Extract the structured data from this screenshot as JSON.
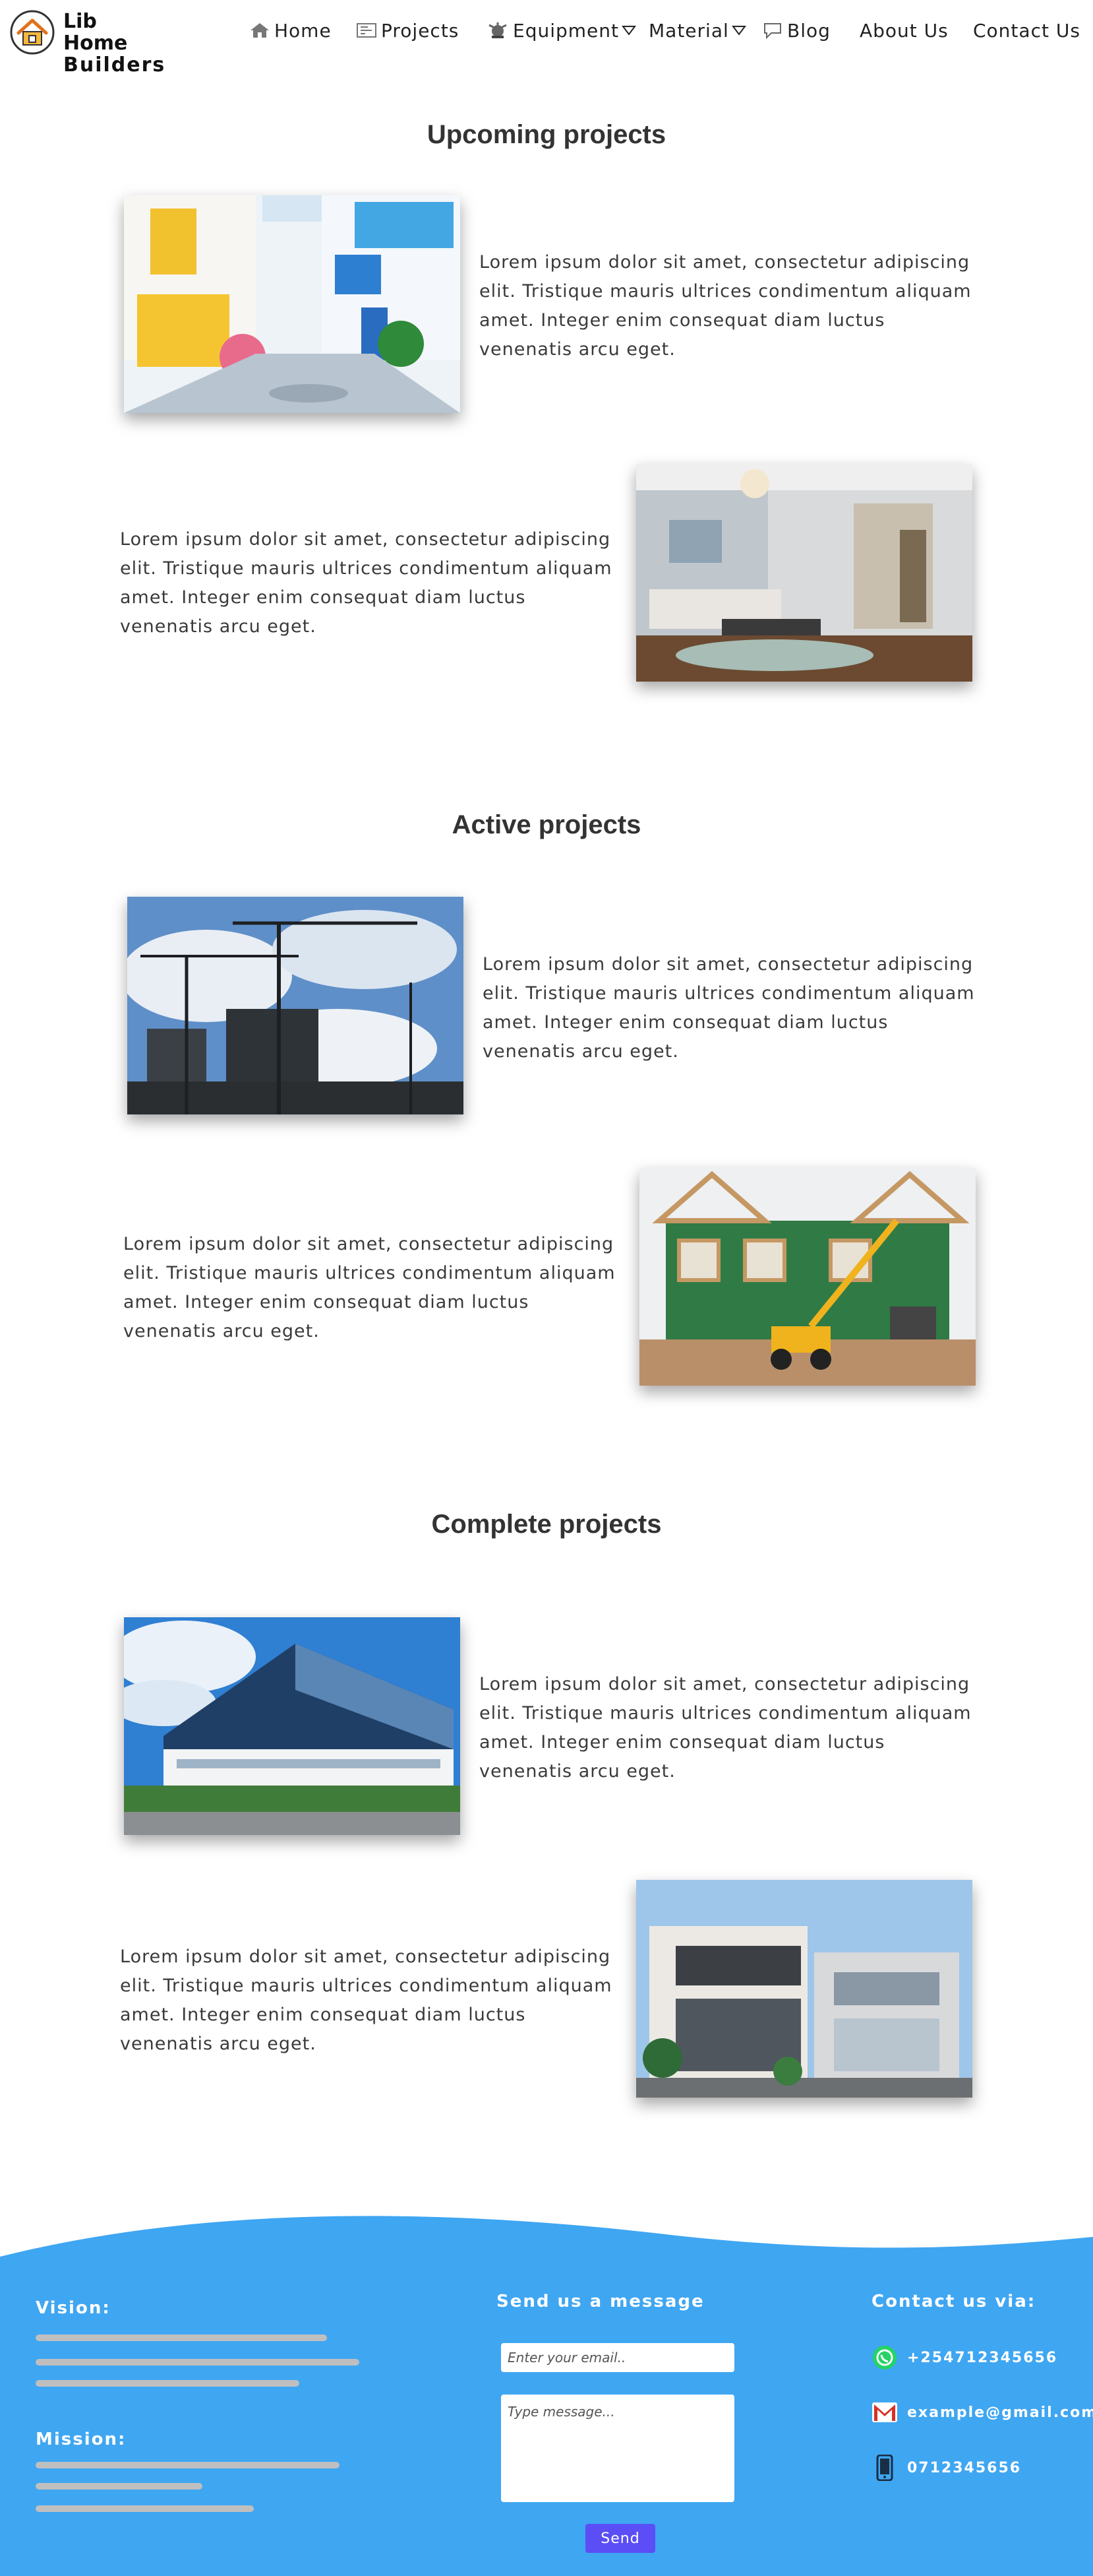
{
  "brand": {
    "line1": "Lib Home",
    "line2": "Builders"
  },
  "nav": {
    "home": "Home",
    "projects": "Projects",
    "equipment": "Equipment",
    "material": "Material",
    "blog": "Blog",
    "about": "About Us",
    "contact": "Contact Us"
  },
  "sections": {
    "upcoming": {
      "title": "Upcoming projects",
      "items": [
        {
          "text": "Lorem ipsum dolor sit amet, consectetur adipiscing elit. Tristique mauris ultrices condimentum aliquam amet. Integer enim consequat diam luctus venenatis arcu eget.",
          "image": "colorful-street-photo"
        },
        {
          "text": "Lorem ipsum dolor sit amet, consectetur adipiscing elit. Tristique mauris ultrices condimentum aliquam amet. Integer enim consequat diam luctus venenatis arcu eget.",
          "image": "living-room-photo"
        }
      ]
    },
    "active": {
      "title": "Active projects",
      "items": [
        {
          "text": "Lorem ipsum dolor sit amet, consectetur adipiscing elit. Tristique mauris ultrices condimentum aliquam amet. Integer enim consequat diam luctus venenatis arcu eget.",
          "image": "cranes-construction-photo"
        },
        {
          "text": "Lorem ipsum dolor sit amet, consectetur adipiscing elit. Tristique mauris ultrices condimentum aliquam amet. Integer enim consequat diam luctus venenatis arcu eget.",
          "image": "house-framing-photo"
        }
      ]
    },
    "complete": {
      "title": "Complete projects",
      "items": [
        {
          "text": "Lorem ipsum dolor sit amet, consectetur adipiscing elit. Tristique mauris ultrices condimentum aliquam amet. Integer enim consequat diam luctus venenatis arcu eget.",
          "image": "glass-office-building-photo"
        },
        {
          "text": "Lorem ipsum dolor sit amet, consectetur adipiscing elit. Tristique mauris ultrices condimentum aliquam amet. Integer enim consequat diam luctus venenatis arcu eget.",
          "image": "modern-house-photo"
        }
      ]
    }
  },
  "footer": {
    "vision": "Vision:",
    "mission": "Mission:",
    "message_heading": "Send us a message",
    "email_placeholder": "Enter your email..",
    "message_placeholder": "Type message...",
    "send": "Send",
    "contact_heading": "Contact us via:",
    "whatsapp": "+254712345656",
    "email": "example@gmail.com",
    "phone": "0712345656"
  },
  "colors": {
    "footer_bg": "#3fa6f2",
    "send_button": "#5b4ef7",
    "placeholder_bars": "#bfbfbf"
  }
}
